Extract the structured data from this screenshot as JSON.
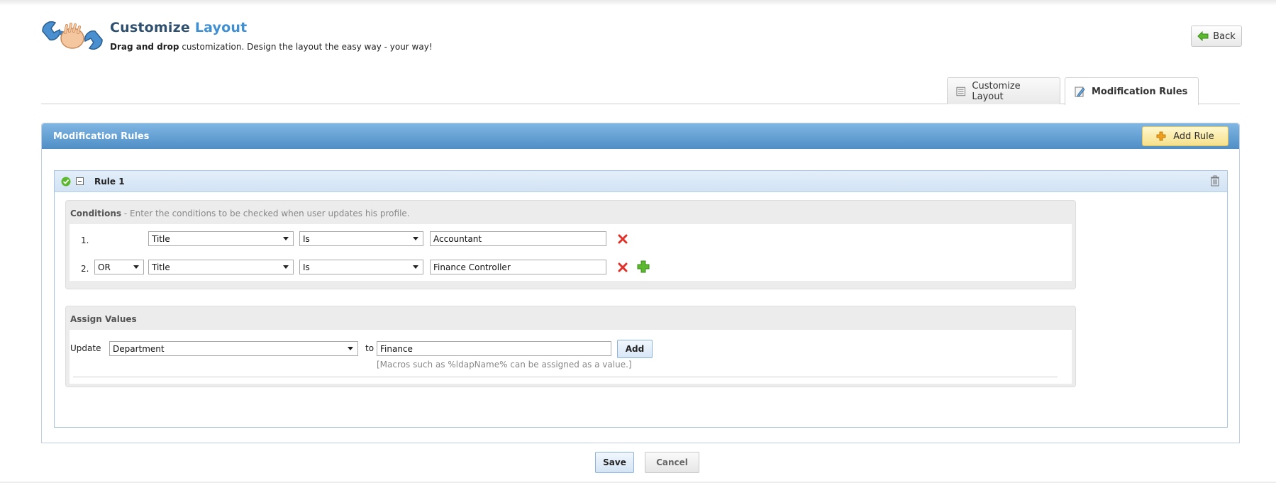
{
  "header": {
    "title_part1": "Customize",
    "title_part2": "Layout",
    "subtitle_bold": "Drag and drop",
    "subtitle_rest": " customization. Design the layout the easy way - your way!",
    "back_label": "Back"
  },
  "tabs": [
    {
      "label": "Customize Layout",
      "active": false,
      "icon": "layout-icon"
    },
    {
      "label": "Modification Rules",
      "active": true,
      "icon": "edit-rules-icon"
    }
  ],
  "panel": {
    "title": "Modification Rules",
    "add_rule_label": "Add Rule"
  },
  "rule": {
    "title": "Rule 1",
    "conditions": {
      "label_bold": "Conditions",
      "label_rest": " - Enter the conditions to be checked when user updates his profile.",
      "rows": [
        {
          "num": "1.",
          "joiner": "",
          "field": "Title",
          "operator": "Is",
          "value": "Accountant"
        },
        {
          "num": "2.",
          "joiner": "OR",
          "field": "Title",
          "operator": "Is",
          "value": "Finance Controller"
        }
      ]
    },
    "assign": {
      "label": "Assign Values",
      "update_label": "Update",
      "field": "Department",
      "to_label": "to",
      "value": "Finance",
      "add_label": "Add",
      "hint": "[Macros such as %ldapName% can be assigned as a value.]"
    }
  },
  "footer": {
    "save_label": "Save",
    "cancel_label": "Cancel"
  },
  "colors": {
    "panel_header": "#4f8ec6",
    "title_accent": "#3f8fd2",
    "remove_red": "#e0322a",
    "add_green": "#5cb82e"
  }
}
